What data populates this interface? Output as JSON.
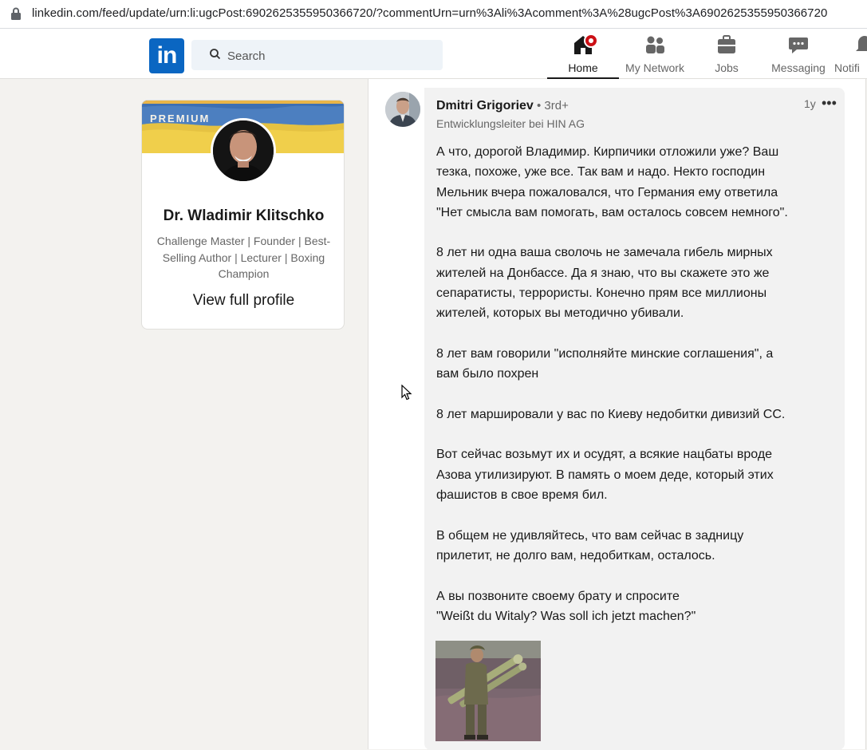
{
  "browser": {
    "url": "linkedin.com/feed/update/urn:li:ugcPost:6902625355950366720/?commentUrn=urn%3Ali%3Acomment%3A%28ugcPost%3A6902625355950366720"
  },
  "header": {
    "logo_text": "in",
    "search_placeholder": "Search",
    "nav": [
      {
        "label": "Home",
        "icon": "home-icon",
        "active": true,
        "has_badge": true
      },
      {
        "label": "My Network",
        "icon": "network-icon"
      },
      {
        "label": "Jobs",
        "icon": "briefcase-icon"
      },
      {
        "label": "Messaging",
        "icon": "chat-icon"
      },
      {
        "label": "Notifi",
        "icon": "bell-icon"
      }
    ]
  },
  "profile": {
    "premium_label": "PREMIUM",
    "name": "Dr. Wladimir Klitschko",
    "headline": "Challenge Master | Founder | Best-Selling Author | Lecturer | Boxing Champion",
    "link_label": "View full profile"
  },
  "comment": {
    "author": "Dmitri Grigoriev",
    "degree": " • 3rd+",
    "author_headline": "Entwicklungsleiter bei HIN AG",
    "timestamp": "1y",
    "more_label": "•••",
    "text": "А что, дорогой Владимир. Кирпичики отложили уже? Ваш\nтезка, похоже, уже все. Так вам и надо. Некто господин\nМельник вчера пожаловался, что Германия ему ответила\n\"Нет смысла вам помогать, вам осталось совсем немного\".\n\n8 лет ни одна ваша сволочь не замечала гибель мирных\nжителей на Донбассе. Да я знаю, что вы скажете это же\nсепаратисты, террористы. Конечно прям все миллионы\nжителей, которых вы методично убивали.\n\n8 лет вам говорили \"исполняйте минские соглашения\", а\nвам было похрен\n\n8 лет маршировали у вас по Киеву недобитки дивизий СС.\n\nВот сейчас возьмут их и осудят, а всякие нацбаты вроде\nАзова утилизируют. В память о моем деде, который этих\nфашистов в свое время бил.\n\nВ общем не удивляйтесь, что вам сейчас в задницу\nприлетит, не долго вам, недобиткам, осталось.\n\nА вы позвоните своему брату и спросите\n\"Weißt du Witaly? Was soll ich jetzt machen?\""
  },
  "colors": {
    "linkedin_blue": "#0a66c2",
    "page_bg": "#f3f2ef",
    "badge_red": "#cc1016",
    "bubble_bg": "#f2f2f2"
  }
}
